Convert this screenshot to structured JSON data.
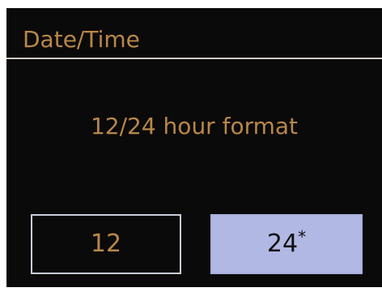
{
  "screen": {
    "title": "Date/Time",
    "prompt": "12/24 hour format"
  },
  "options": [
    {
      "label": "12",
      "marker": "",
      "selected": false
    },
    {
      "label": "24",
      "marker": "*",
      "selected": true
    }
  ],
  "colors": {
    "background": "#0b0a0a",
    "text_amber": "#b8874a",
    "divider": "#cfc7bf",
    "selected_fill": "#b1b8e4",
    "selected_text": "#101010",
    "unselected_border": "#c9ced8"
  }
}
